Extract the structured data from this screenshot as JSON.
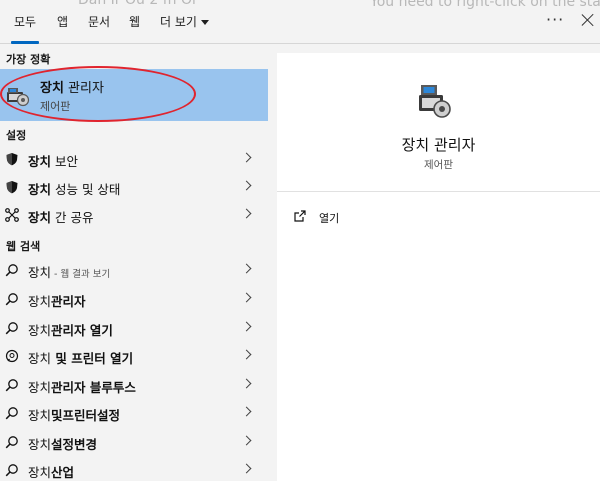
{
  "background": {
    "text_right": "You need to right-click on the start",
    "text_left": "Dan Ir  Ou  2   fn  Or"
  },
  "tabs": [
    {
      "label": "모두",
      "active": true
    },
    {
      "label": "앱"
    },
    {
      "label": "문서"
    },
    {
      "label": "웹"
    },
    {
      "label": "더 보기"
    }
  ],
  "topbar": {
    "more_label": "···"
  },
  "left": {
    "best_match_header": "가장 정확",
    "best_match": {
      "title_bold": "장치",
      "title_rest": " 관리자",
      "subtitle": "제어판"
    },
    "settings_header": "설정",
    "settings": [
      {
        "bold": "장치",
        "rest": " 보안",
        "icon": "shield-icon"
      },
      {
        "bold": "장치",
        "rest": " 성능 및 상태",
        "icon": "shield-icon"
      },
      {
        "bold": "장치",
        "rest": " 간 공유",
        "icon": "share-icon"
      }
    ],
    "web_header": "웹 검색",
    "web": [
      {
        "plain": "장치",
        "bold": "",
        "small": " - 웹 결과 보기"
      },
      {
        "plain": "장치",
        "bold": "관리자",
        "small": ""
      },
      {
        "plain": "장치",
        "bold": "관리자 열기",
        "small": ""
      },
      {
        "plain": "장치",
        "bold": " 및 프린터 열기",
        "small": ""
      },
      {
        "plain": "장치",
        "bold": "관리자 블루투스",
        "small": ""
      },
      {
        "plain": "장치",
        "bold": "및프린터설정",
        "small": ""
      },
      {
        "plain": "장치",
        "bold": "설정변경",
        "small": ""
      },
      {
        "plain": "장치",
        "bold": "산업",
        "small": ""
      }
    ]
  },
  "detail": {
    "title": "장치 관리자",
    "subtitle": "제어판",
    "actions": [
      {
        "label": "열기",
        "icon": "open-icon"
      }
    ]
  },
  "colors": {
    "accent": "#0067c0",
    "highlight": "#99c4ee",
    "annotation": "#e0242e"
  }
}
